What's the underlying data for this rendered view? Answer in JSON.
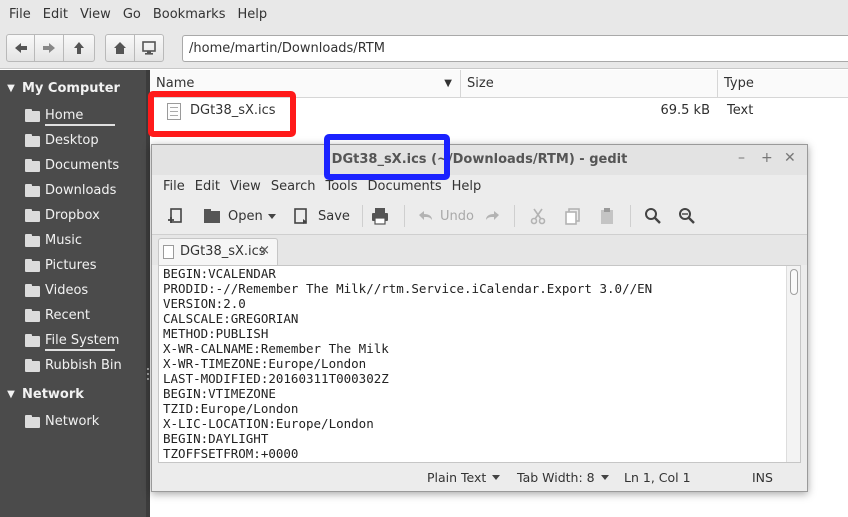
{
  "fm": {
    "menu": [
      "File",
      "Edit",
      "View",
      "Go",
      "Bookmarks",
      "Help"
    ],
    "location": "/home/martin/Downloads/RTM"
  },
  "sidebar": {
    "section1": "My Computer",
    "items": [
      {
        "label": "Home",
        "icon": "home-folder-icon"
      },
      {
        "label": "Desktop",
        "icon": "desktop-folder-icon"
      },
      {
        "label": "Documents",
        "icon": "documents-folder-icon"
      },
      {
        "label": "Downloads",
        "icon": "downloads-folder-icon"
      },
      {
        "label": "Dropbox",
        "icon": "dropbox-folder-icon"
      },
      {
        "label": "Music",
        "icon": "music-folder-icon"
      },
      {
        "label": "Pictures",
        "icon": "pictures-folder-icon"
      },
      {
        "label": "Videos",
        "icon": "videos-folder-icon"
      },
      {
        "label": "Recent",
        "icon": "recent-icon"
      },
      {
        "label": "File System",
        "icon": "drive-icon"
      },
      {
        "label": "Rubbish Bin",
        "icon": "trash-icon"
      }
    ],
    "section2": "Network",
    "network_items": [
      {
        "label": "Network",
        "icon": "network-icon"
      }
    ]
  },
  "list": {
    "columns": [
      "Name",
      "Size",
      "Type"
    ],
    "files": [
      {
        "name": "DGt38_sX.ics",
        "size": "69.5 kB",
        "type": "Text"
      }
    ]
  },
  "gedit": {
    "title": "DGt38_sX.ics (~/Downloads/RTM) - gedit",
    "menu": [
      "File",
      "Edit",
      "View",
      "Search",
      "Tools",
      "Documents",
      "Help"
    ],
    "toolbar": {
      "open": "Open",
      "save": "Save",
      "undo": "Undo"
    },
    "tab": "DGt38_sX.ics",
    "lines": [
      "BEGIN:VCALENDAR",
      "PRODID:-//Remember The Milk//rtm.Service.iCalendar.Export 3.0//EN",
      "VERSION:2.0",
      "CALSCALE:GREGORIAN",
      "METHOD:PUBLISH",
      "X-WR-CALNAME:Remember The Milk",
      "X-WR-TIMEZONE:Europe/London",
      "LAST-MODIFIED:20160311T000302Z",
      "BEGIN:VTIMEZONE",
      "TZID:Europe/London",
      "X-LIC-LOCATION:Europe/London",
      "BEGIN:DAYLIGHT",
      "TZOFFSETFROM:+0000"
    ],
    "status": {
      "syntax": "Plain Text",
      "tabwidth": "Tab Width:  8",
      "position": "Ln 1, Col 1",
      "mode": "INS"
    }
  },
  "colors": {
    "sidebar_bg": "#4b4b4b",
    "highlight_red": "#ff1a1a",
    "highlight_blue": "#1a22ff"
  }
}
